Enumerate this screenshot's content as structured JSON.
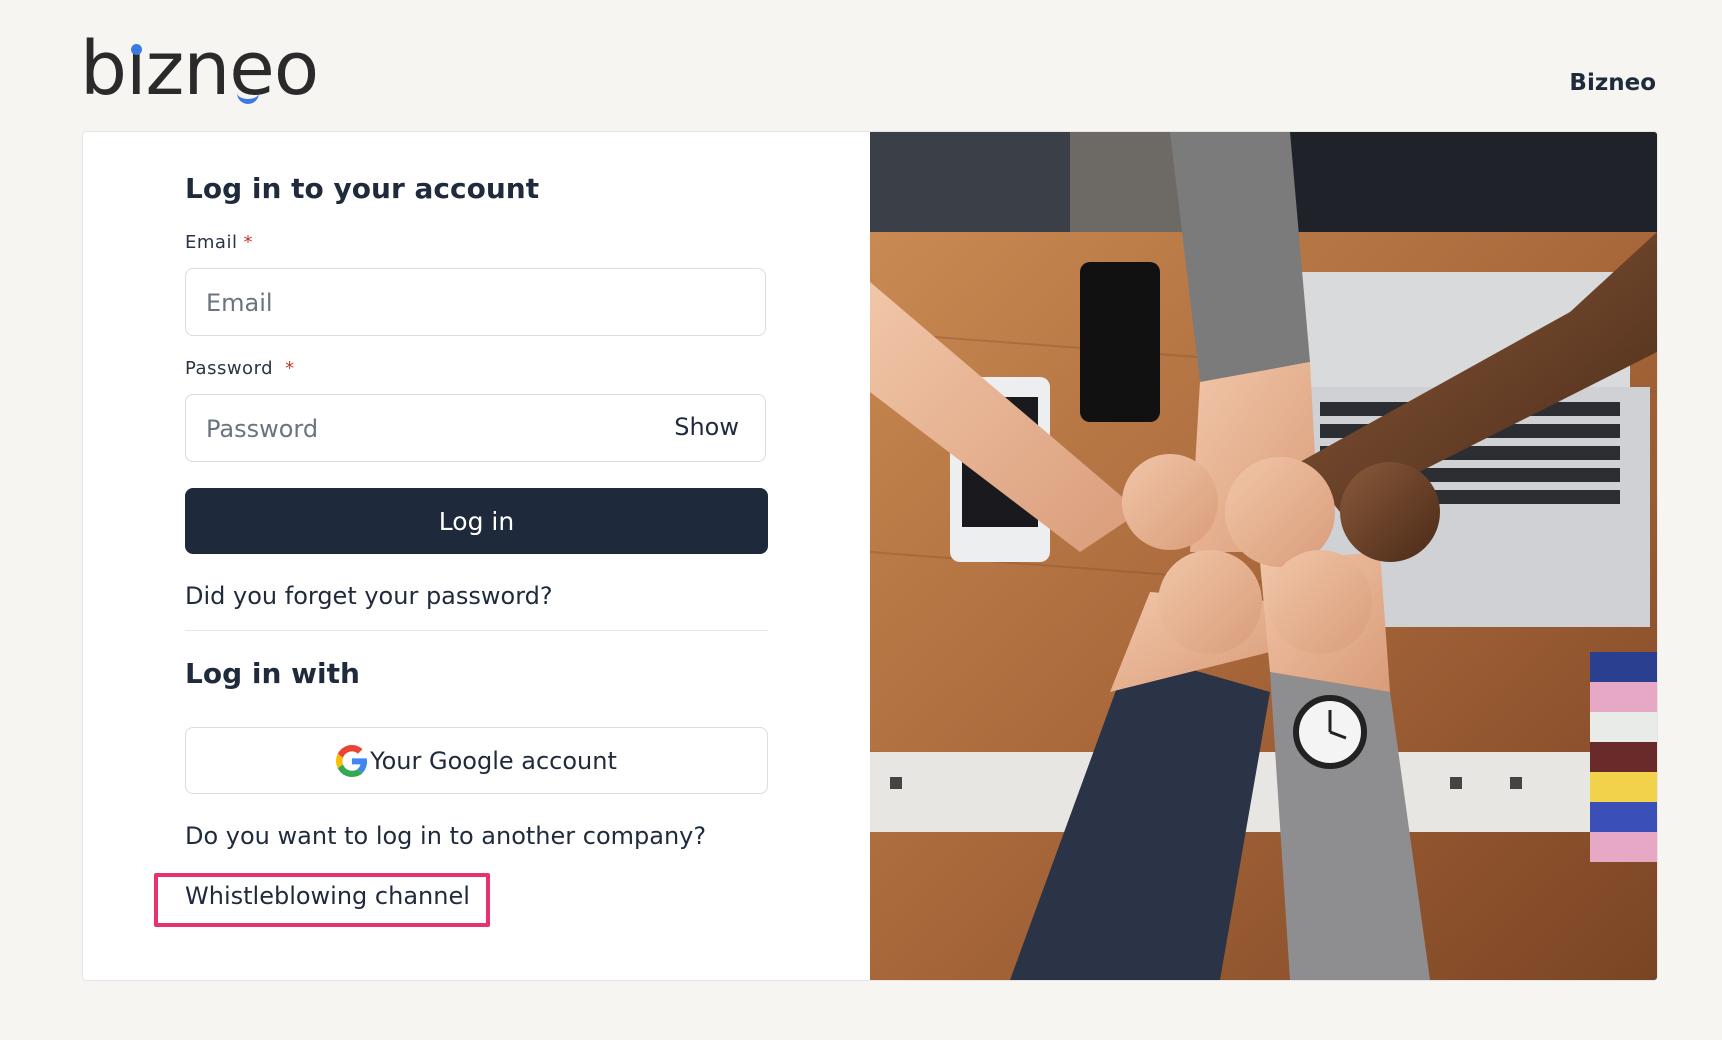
{
  "header": {
    "logo_text": "bizneo",
    "top_link": "Bizneo"
  },
  "form": {
    "title": "Log in to your account",
    "email_label": "Email",
    "email_placeholder": "Email",
    "password_label": "Password",
    "password_placeholder": "Password",
    "show_label": "Show",
    "required_mark": "*",
    "login_button": "Log in",
    "forgot_link": "Did you forget your password?",
    "login_with_title": "Log in with",
    "google_button": "Your Google account",
    "another_company": "Do you want to log in to another company?",
    "whistleblowing_link": "Whistleblowing channel"
  },
  "colors": {
    "primary_button": "#1e293b",
    "highlight_box": "#e6336f",
    "logo_accent": "#3b7be0"
  },
  "icons": {
    "google": "google-icon"
  }
}
